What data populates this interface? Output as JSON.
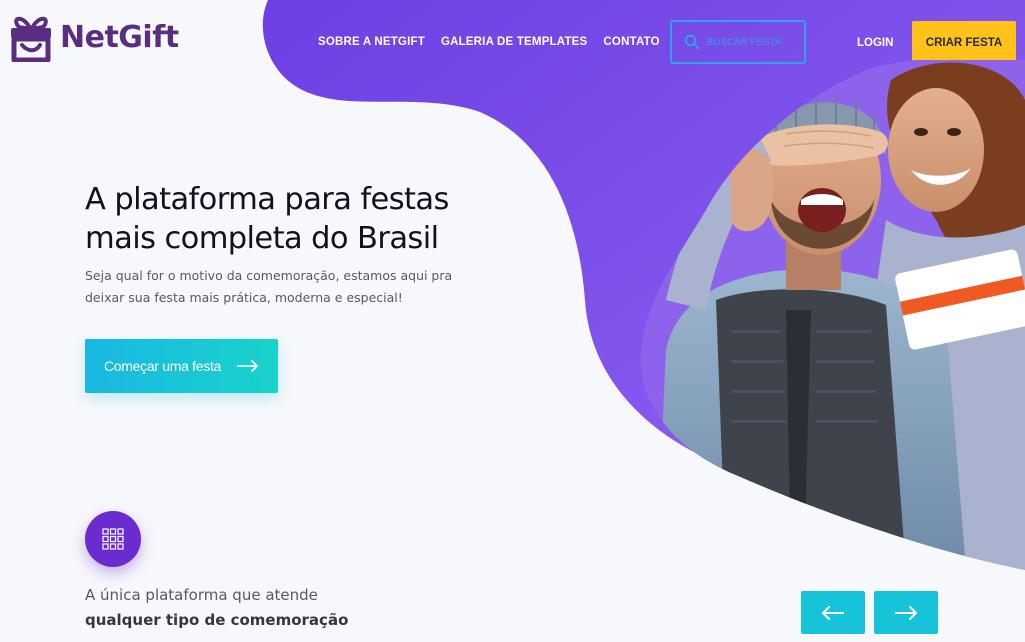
{
  "brand": {
    "name": "NetGift",
    "color": "#5a2d82"
  },
  "nav": {
    "items": [
      {
        "label": "SOBRE A NETGIFT"
      },
      {
        "label": "GALERIA DE TEMPLATES"
      },
      {
        "label": "CONTATO"
      }
    ],
    "search_label": "BUSCAR FESTA",
    "login_label": "LOGIN",
    "create_label": "CRIAR FESTA"
  },
  "hero": {
    "title": "A plataforma para festas mais completa do Brasil",
    "subtitle": "Seja qual for o motivo da comemoração, estamos aqui pra deixar sua festa mais prática, moderna e especial!",
    "cta_label": "Começar uma festa"
  },
  "features": {
    "tagline_line1": "A única plataforma que atende",
    "tagline_line2": "qualquer tipo de comemoração"
  },
  "icons": {
    "logo": "gift-icon",
    "search": "search-icon",
    "cta_arrow": "arrow-right-icon",
    "badge": "grid-icon",
    "prev": "arrow-left-icon",
    "next": "arrow-right-icon"
  },
  "colors": {
    "purple": "#7b4be8",
    "yellow": "#ffc21a",
    "cyan": "#16c3d8",
    "search_border": "#2ea3e8"
  }
}
